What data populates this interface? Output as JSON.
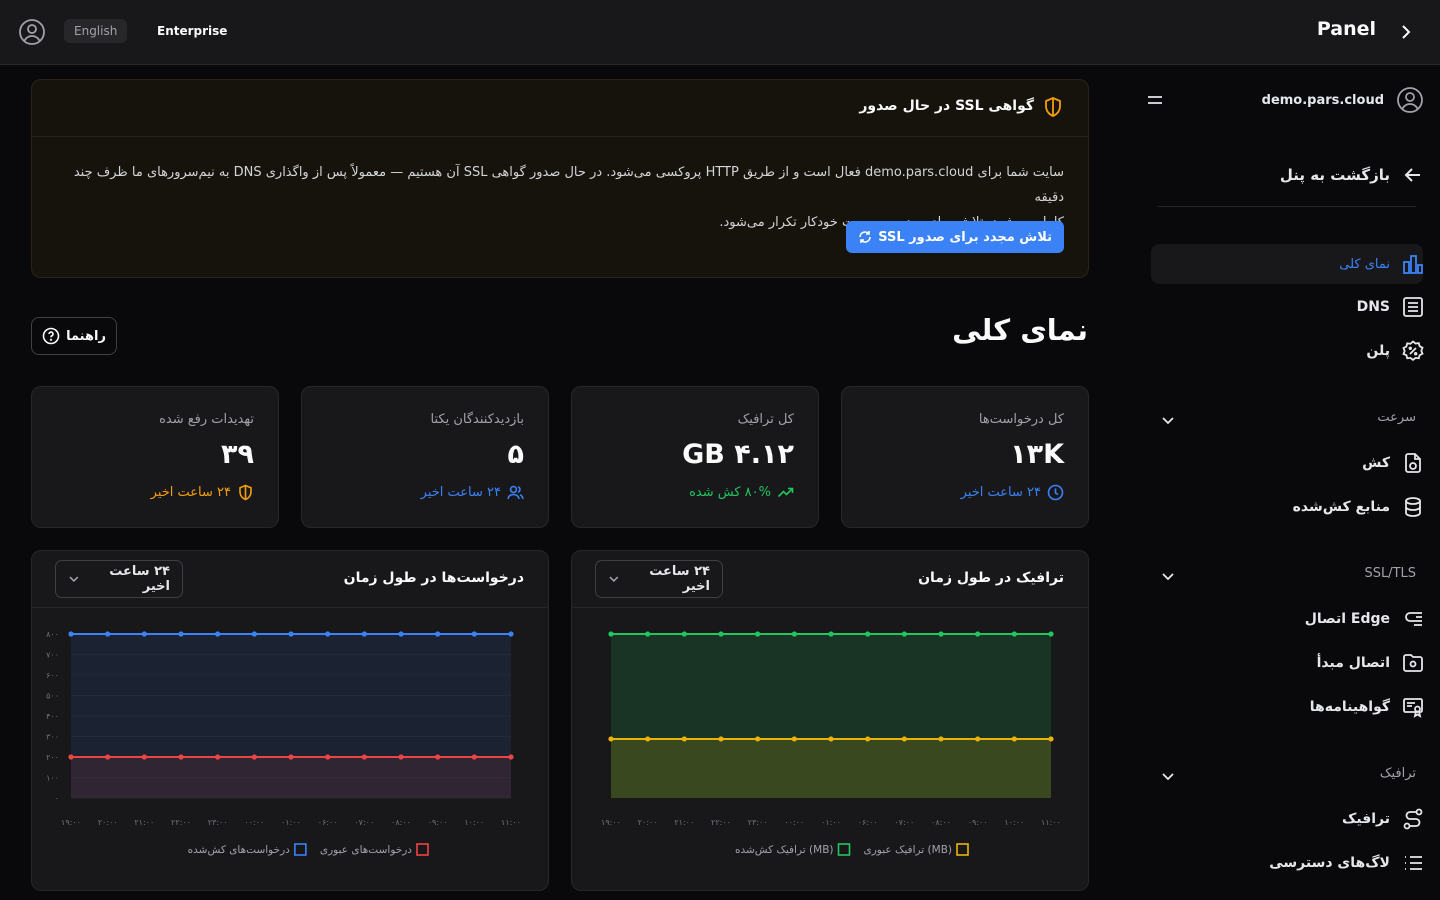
{
  "topbar": {
    "lang": "English",
    "plan": "Enterprise",
    "title": "Panel"
  },
  "sidebar": {
    "domain": "demo.pars.cloud",
    "back": "بازگشت به پنل",
    "items": [
      {
        "label": "نمای کلی",
        "icon": "bar-chart-icon",
        "active": true
      },
      {
        "label": "DNS",
        "icon": "list-icon"
      },
      {
        "label": "پلن",
        "icon": "badge-percent-icon"
      }
    ],
    "sections": [
      {
        "title": "سرعت",
        "items": [
          {
            "label": "کش",
            "icon": "file-cache-icon"
          },
          {
            "label": "منابع کش‌شده",
            "icon": "database-icon"
          }
        ]
      },
      {
        "title": "SSL/TLS",
        "items": [
          {
            "label": "اتصال Edge",
            "icon": "edge-icon"
          },
          {
            "label": "اتصال مبدأ",
            "icon": "folder-origin-icon"
          },
          {
            "label": "گواهینامه‌ها",
            "icon": "certificate-icon"
          }
        ]
      },
      {
        "title": "ترافیک",
        "items": [
          {
            "label": "ترافیک",
            "icon": "route-icon"
          },
          {
            "label": "لاگ‌های دسترسی",
            "icon": "list-ordered-icon"
          }
        ]
      }
    ]
  },
  "ssl": {
    "title": "گواهی SSL در حال صدور",
    "line1": "سایت شما برای demo.pars.cloud فعال است و از طریق HTTP پروکسی می‌شود. در حال صدور گواهی SSL آن هستیم — معمولاً پس از واگذاری DNS به نیم‌سرورهای ما ظرف چند دقیقه",
    "line2": "کامل می‌شود. تلاش برای صدور به‌صورت خودکار تکرار می‌شود.",
    "button": "تلاش مجدد برای صدور SSL"
  },
  "page": {
    "title": "نمای کلی",
    "help": "راهنما"
  },
  "stats": [
    {
      "label": "کل درخواست‌ها",
      "value": "۱۳K",
      "sub": "۲۴ ساعت اخیر",
      "sub_color": "#3b82f6",
      "icon": "clock-icon"
    },
    {
      "label": "کل ترافیک",
      "value": "۴.۱۲ GB",
      "sub": "۸۰% کش شده",
      "sub_color": "#22c55e",
      "icon": "trending-up-icon"
    },
    {
      "label": "بازدیدکنندگان یکتا",
      "value": "۵",
      "sub": "۲۴ ساعت اخیر",
      "sub_color": "#3b82f6",
      "icon": "users-icon"
    },
    {
      "label": "تهدیدات رفع شده",
      "value": "۳۹",
      "sub": "۲۴ ساعت اخیر",
      "sub_color": "#f59e0b",
      "icon": "shield-icon"
    }
  ],
  "colors": {
    "blue": "#3b82f6",
    "red": "#ef4444",
    "green": "#22c55e",
    "yellow": "#eab308"
  },
  "chart_data": [
    {
      "type": "line",
      "title": "ترافیک در طول زمان",
      "range": "۲۴ ساعت اخیر",
      "x": [
        "۱۹:۰۰",
        "۲۰:۰۰",
        "۲۱:۰۰",
        "۲۲:۰۰",
        "۲۳:۰۰",
        "۰۰:۰۰",
        "۰۱:۰۰",
        "۰۶:۰۰",
        "۰۷:۰۰",
        "۰۸:۰۰",
        "۰۹:۰۰",
        "۱۰:۰۰",
        "۱۱:۰۰"
      ],
      "ylim": [
        0,
        100
      ],
      "show_y_ticks": false,
      "series": [
        {
          "name": "ترافیک کش‌شده (MB)",
          "color": "#22c55e",
          "values": [
            100,
            100,
            100,
            100,
            100,
            100,
            100,
            100,
            100,
            100,
            100,
            100,
            100
          ]
        },
        {
          "name": "ترافیک عبوری (MB)",
          "color": "#eab308",
          "values": [
            36,
            36,
            36,
            36,
            36,
            36,
            36,
            36,
            36,
            36,
            36,
            36,
            36
          ]
        }
      ]
    },
    {
      "type": "line",
      "title": "درخواست‌ها در طول زمان",
      "range": "۲۴ ساعت اخیر",
      "x": [
        "۱۹:۰۰",
        "۲۰:۰۰",
        "۲۱:۰۰",
        "۲۲:۰۰",
        "۲۳:۰۰",
        "۰۰:۰۰",
        "۰۱:۰۰",
        "۰۶:۰۰",
        "۰۷:۰۰",
        "۰۸:۰۰",
        "۰۹:۰۰",
        "۱۰:۰۰",
        "۱۱:۰۰"
      ],
      "yticks": [
        "۰",
        "۱۰۰",
        "۲۰۰",
        "۳۰۰",
        "۴۰۰",
        "۵۰۰",
        "۶۰۰",
        "۷۰۰",
        "۸۰۰"
      ],
      "ylim": [
        0,
        800
      ],
      "show_y_ticks": true,
      "series": [
        {
          "name": "درخواست‌های کش‌شده",
          "color": "#3b82f6",
          "values": [
            800,
            800,
            800,
            800,
            800,
            800,
            800,
            800,
            800,
            800,
            800,
            800,
            800
          ]
        },
        {
          "name": "درخواست‌های عبوری",
          "color": "#ef4444",
          "values": [
            200,
            200,
            200,
            200,
            200,
            200,
            200,
            200,
            200,
            200,
            200,
            200,
            200
          ]
        }
      ]
    }
  ]
}
